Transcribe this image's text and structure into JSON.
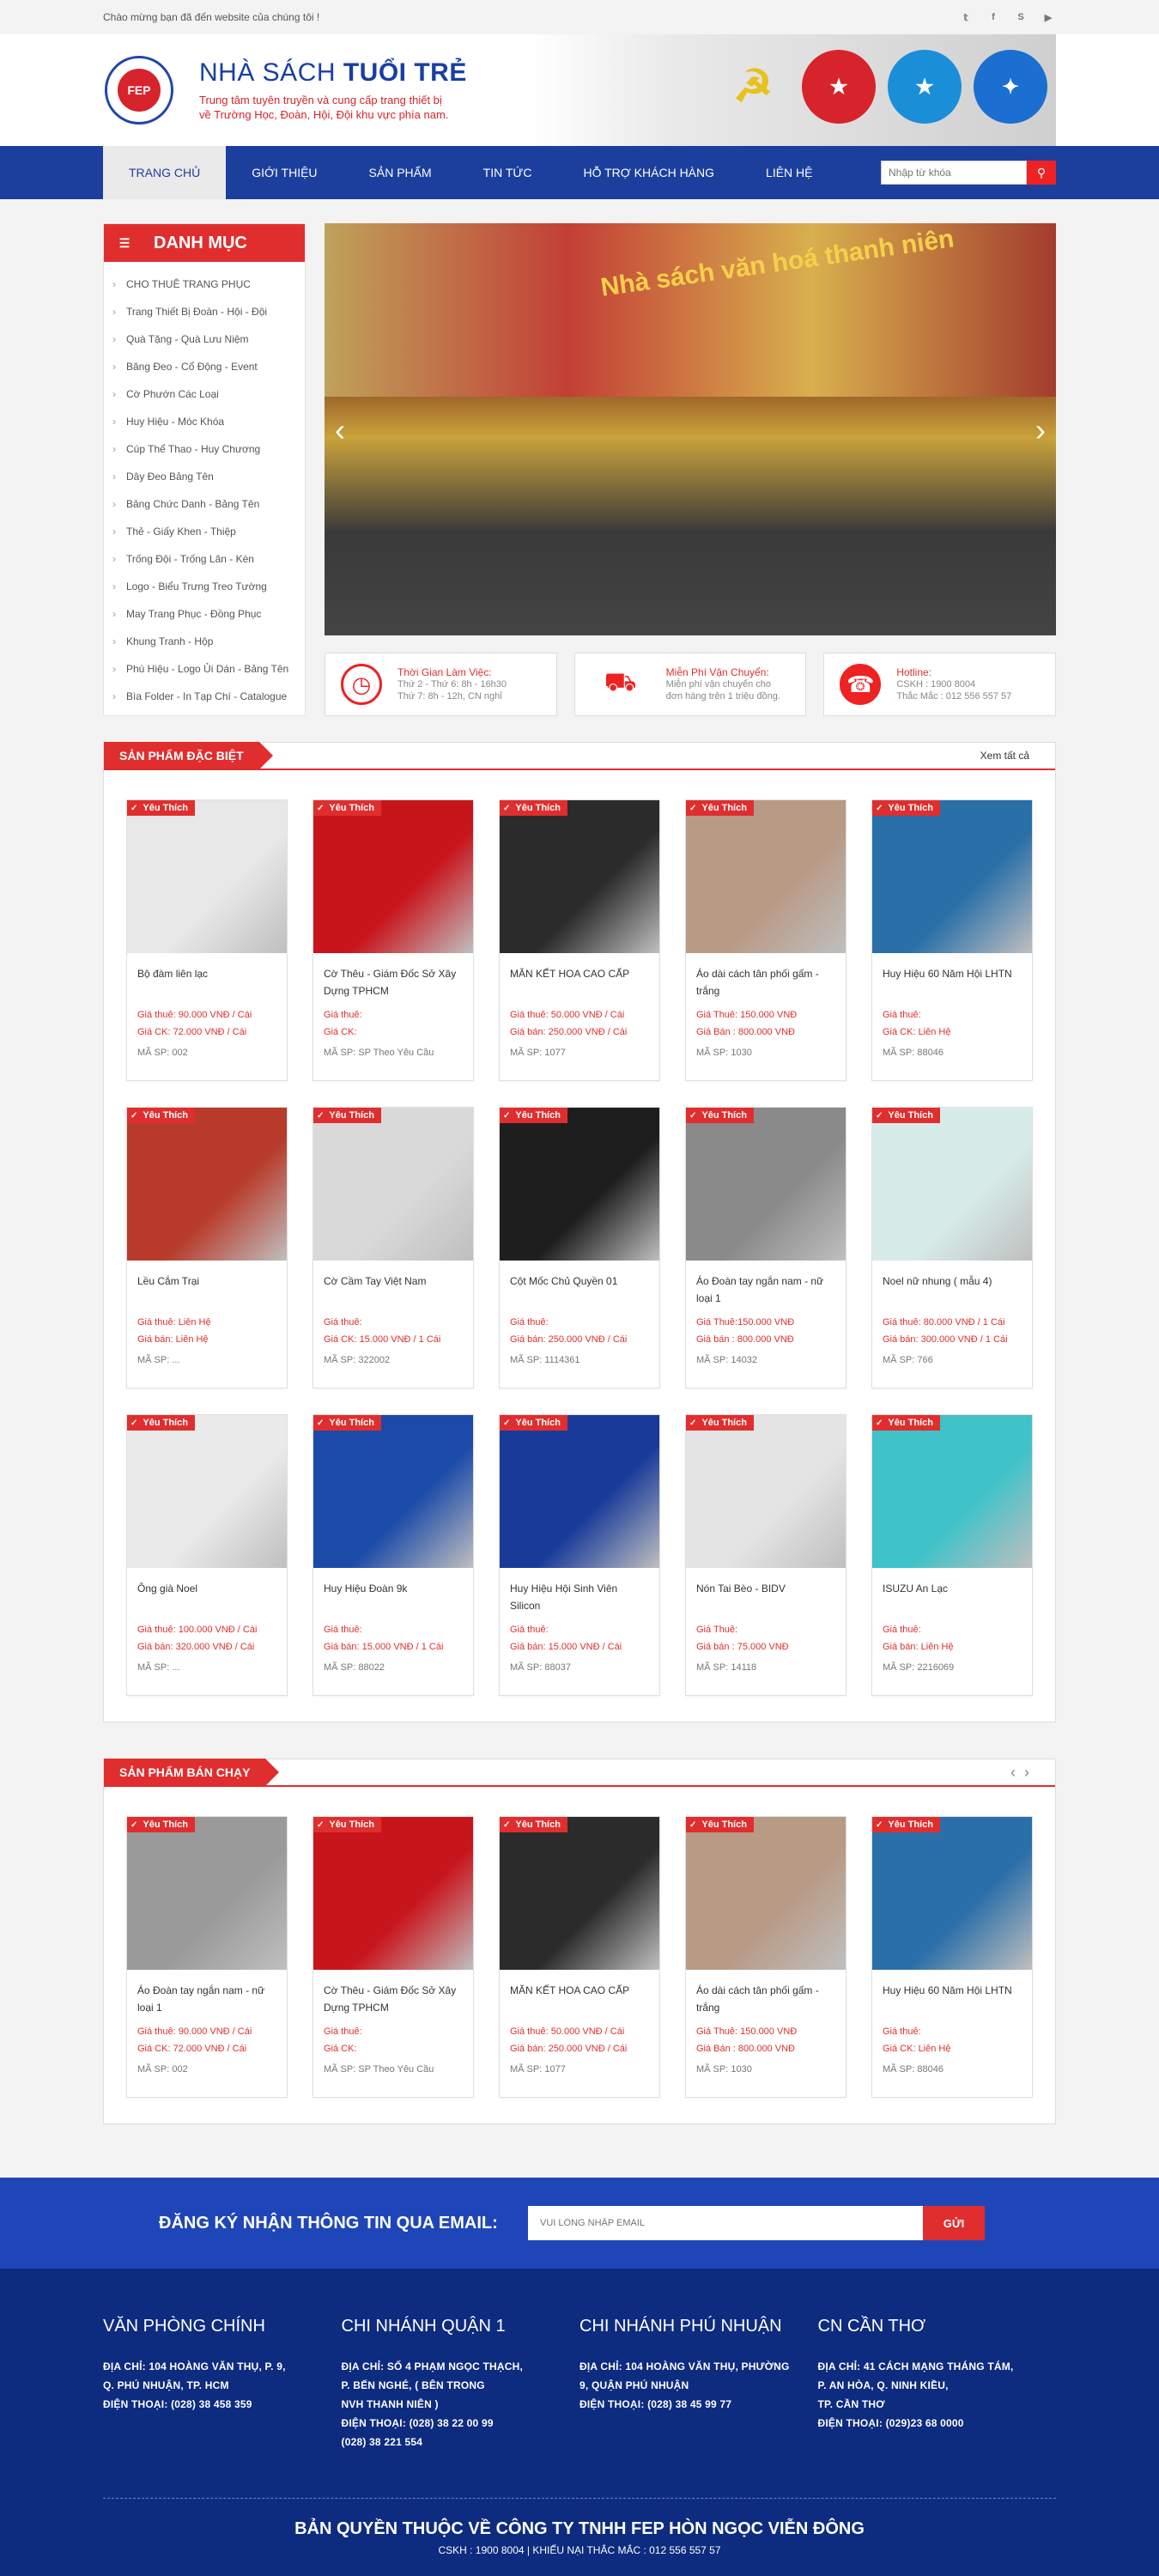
{
  "topbar": {
    "welcome": "Chào mừng bạn đã đến website của chúng tôi !",
    "social": [
      "twitter-icon",
      "facebook-icon",
      "skype-icon",
      "youtube-icon"
    ]
  },
  "header": {
    "logo_text": "FEP",
    "name_light": "NHÀ SÁCH ",
    "name_bold": "TUỔI TRẺ",
    "tagline1": "Trung tâm tuyên truyền và cung cấp trang thiết bị",
    "tagline2": "về Trường Học, Đoàn, Hội, Đội khu vực phía nam."
  },
  "nav": {
    "items": [
      "TRANG CHỦ",
      "GIỚI THIỆU",
      "SẢN PHẨM",
      "TIN TỨC",
      "HỖ TRỢ KHÁCH HÀNG",
      "LIÊN HỆ"
    ],
    "search_placeholder": "Nhập từ khóa"
  },
  "category": {
    "title": "DANH MỤC",
    "items": [
      "CHO THUÊ TRANG PHỤC",
      "Trang Thiết Bị Đoàn - Hội - Đội",
      "Quà Tặng - Quà Lưu Niệm",
      "Băng Đeo - Cổ Động - Event",
      "Cờ Phướn Các Loại",
      "Huy Hiệu - Móc Khóa",
      "Cúp Thể Thao - Huy Chương",
      "Dây Đeo Bảng Tên",
      "Bảng Chức Danh - Bảng Tên",
      "Thẻ - Giấy Khen - Thiệp",
      "Trống Đội - Trống Lân - Kèn",
      "Logo - Biểu Trưng Treo Tường",
      "May Trang Phục - Đồng Phục",
      "Khung Tranh - Hộp",
      "Phù Hiệu - Logo Ủi Dán - Bảng Tên",
      "Bìa Folder - In Tạp Chí - Catalogue"
    ]
  },
  "slider": {
    "sign": "Nhà sách văn hoá thanh niên"
  },
  "infos": [
    {
      "title": "Thời Gian Làm Việc:",
      "line1": "Thứ 2 - Thứ 6: 8h - 16h30",
      "line2": "Thứ 7: 8h - 12h, CN nghỉ"
    },
    {
      "title": "Miễn Phí Vận Chuyển:",
      "line1": "Miễn phí vận chuyển cho",
      "line2": "đơn hàng trên 1 triệu đồng."
    },
    {
      "title": "Hotline:",
      "line1": "CSKH : 1900 8004",
      "line2": "Thắc Mắc : 012 556 557 57"
    }
  ],
  "featured": {
    "title": "SẢN PHẨM ĐẶC BIỆT",
    "more": "Xem tất cả",
    "badge": "Yêu Thích",
    "products": [
      {
        "title": "Bộ đàm liên lạc",
        "p1": "Giá thuê: 90.000 VNĐ / Cái",
        "p2": "Giá CK: 72.000 VNĐ / Cái",
        "sku": "MÃ SP: 002",
        "color": "#e8e8e8"
      },
      {
        "title": "Cờ Thêu - Giám Đốc Sở Xây Dựng TPHCM",
        "p1": "Giá thuê:",
        "p2": "Giá CK:",
        "sku": "MÃ SP: SP Theo Yêu Cầu",
        "color": "#c8151c"
      },
      {
        "title": "MĂN KẾT HOA CAO CẤP",
        "p1": "Giá thuê: 50.000 VNĐ / Cái",
        "p2": "Giá bán: 250.000 VNĐ / Cái",
        "sku": "MÃ SP: 1077",
        "color": "#2b2b2b"
      },
      {
        "title": "Áo dài cách tân phối gấm - trắng",
        "p1": "Giá Thuê: 150.000 VNĐ",
        "p2": "Giá Bán : 800.000 VNĐ",
        "sku": "MÃ SP: 1030",
        "color": "#b89a85"
      },
      {
        "title": "Huy Hiệu 60 Năm Hội LHTN",
        "p1": "Giá thuê:",
        "p2": "Giá CK: Liên Hệ",
        "sku": "MÃ SP: 88046",
        "color": "#2a6fa8"
      },
      {
        "title": "Lều Cắm Trại",
        "p1": "Giá thuê: Liên Hệ",
        "p2": "Giá bán: Liên Hệ",
        "sku": "MÃ SP: ...",
        "color": "#b83a2a"
      },
      {
        "title": "Cờ Cầm Tay Việt Nam",
        "p1": "Giá thuê:",
        "p2": "Giá CK: 15.000 VNĐ / 1 Cái",
        "sku": "MÃ SP: 322002",
        "color": "#d9d9d9"
      },
      {
        "title": "Cột Mốc Chủ Quyền 01",
        "p1": "Giá thuê:",
        "p2": "Giá bán: 250.000 VNĐ / Cái",
        "sku": "MÃ SP: 1114361",
        "color": "#1e1e1e"
      },
      {
        "title": "Áo Đoàn tay ngắn nam - nữ loại 1",
        "p1": "Giá Thuê:150.000 VNĐ",
        "p2": "Giá bán : 800.000 VNĐ",
        "sku": "MÃ SP: 14032",
        "color": "#8a8a8a"
      },
      {
        "title": "Noel nữ nhung ( mẫu 4)",
        "p1": "Giá thuê: 80.000 VNĐ / 1 Cái",
        "p2": "Giá bán: 300.000 VNĐ / 1 Cái",
        "sku": "MÃ SP: 766",
        "color": "#d7ece9"
      },
      {
        "title": "Ông già Noel",
        "p1": "Giá thuê: 100.000 VNĐ / Cái",
        "p2": "Giá bán: 320.000 VNĐ / Cái",
        "sku": "MÃ SP: ...",
        "color": "#eaeaea"
      },
      {
        "title": "Huy Hiệu Đoàn 9k",
        "p1": "Giá thuê:",
        "p2": "Giá bán: 15.000 VNĐ / 1 Cái",
        "sku": "MÃ SP: 88022",
        "color": "#1c4aa8"
      },
      {
        "title": "Huy Hiệu Hội Sinh Viên Silicon",
        "p1": "Giá thuê:",
        "p2": "Giá bán: 15.000 VNĐ / Cái",
        "sku": "MÃ SP: 88037",
        "color": "#1a3a9a"
      },
      {
        "title": "Nón Tai Bèo - BIDV",
        "p1": "Giá Thuê:",
        "p2": "Giá bán : 75.000 VNĐ",
        "sku": "MÃ SP: 14118",
        "color": "#e4e4e4"
      },
      {
        "title": "ISUZU An Lạc",
        "p1": "Giá thuê:",
        "p2": "Giá bán: Liên Hệ",
        "sku": "MÃ SP: 2216069",
        "color": "#3fc2c8"
      }
    ]
  },
  "bestsell": {
    "title": "SẢN PHẨM BÁN CHẠY",
    "badge": "Yêu Thích",
    "products": [
      {
        "title": "Áo Đoàn tay ngắn nam - nữ loại 1",
        "p1": "Giá thuê: 90.000 VNĐ / Cái",
        "p2": "Giá CK: 72.000 VNĐ / Cái",
        "sku": "MÃ SP: 002",
        "color": "#9a9a9a"
      },
      {
        "title": "Cờ Thêu - Giám Đốc Sở Xây Dựng TPHCM",
        "p1": "Giá thuê:",
        "p2": "Giá CK:",
        "sku": "MÃ SP: SP Theo Yêu Cầu",
        "color": "#c8151c"
      },
      {
        "title": "MĂN KẾT HOA CAO CẤP",
        "p1": "Giá thuê: 50.000 VNĐ / Cái",
        "p2": "Giá bán: 250.000 VNĐ / Cái",
        "sku": "MÃ SP: 1077",
        "color": "#2b2b2b"
      },
      {
        "title": "Áo dài cách tân phối gấm - trắng",
        "p1": "Giá Thuê: 150.000 VNĐ",
        "p2": "Giá Bán : 800.000 VNĐ",
        "sku": "MÃ SP: 1030",
        "color": "#b89a85"
      },
      {
        "title": "Huy Hiệu 60 Năm Hội LHTN",
        "p1": "Giá thuê:",
        "p2": "Giá CK: Liên Hệ",
        "sku": "MÃ SP: 88046",
        "color": "#2a6fa8"
      }
    ]
  },
  "newsletter": {
    "label": "ĐĂNG KÝ NHẬN THÔNG TIN QUA EMAIL:",
    "placeholder": "VUI LÒNG NHẬP EMAIL",
    "button": "GỬI"
  },
  "footer": {
    "cols": [
      {
        "title": "VĂN PHÒNG CHÍNH",
        "lines": [
          "ĐỊA CHỈ: 104 HOÀNG VĂN THỤ, P. 9,",
          "Q. PHÚ NHUẬN, TP. HCM",
          "ĐIỆN THOẠI: (028) 38 458 359"
        ]
      },
      {
        "title": "CHI NHÁNH QUẬN 1",
        "lines": [
          "ĐỊA CHỈ: SỐ 4 PHẠM NGỌC THẠCH,",
          "P. BẾN NGHÉ, ( BÊN TRONG",
          "NVH THANH NIÊN )",
          "ĐIỆN THOẠI: (028) 38 22 00 99",
          "(028) 38 221 554"
        ]
      },
      {
        "title": "CHI NHÁNH PHÚ NHUẬN",
        "lines": [
          "ĐỊA CHỈ: 104 HOÀNG VĂN THỤ, PHƯỜNG",
          "9, QUẬN PHÚ NHUẬN",
          "ĐIỆN THOẠI: (028) 38 45 99 77"
        ]
      },
      {
        "title": "CN CẦN THƠ",
        "lines": [
          "ĐỊA CHỈ: 41 CÁCH MẠNG THÁNG TÁM,",
          "P. AN HÒA, Q. NINH KIỀU,",
          "TP. CẦN THƠ",
          "ĐIỆN THOẠI: (029)23 68 0000"
        ]
      }
    ],
    "copyright": "BẢN QUYỀN THUỘC VỀ CÔNG TY TNHH FEP HÒN NGỌC VIỄN ĐÔNG",
    "contact": "CSKH : 1900 8004 | KHIẾU NẠI THẮC MẮC : 012 556 557 57"
  }
}
